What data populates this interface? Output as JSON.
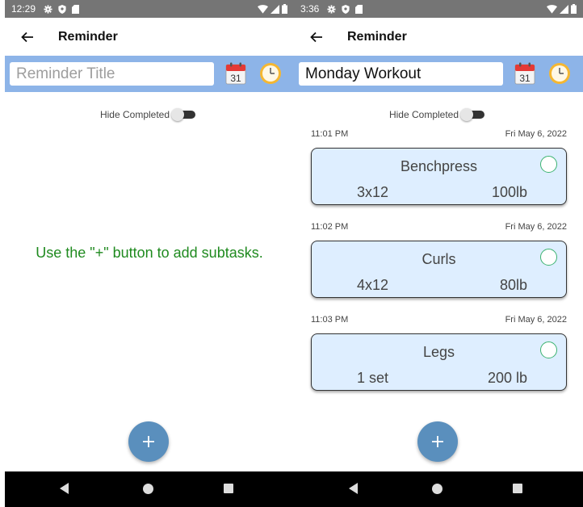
{
  "screens": [
    {
      "statusbar": {
        "time": "12:29"
      },
      "appbar": {
        "title": "Reminder"
      },
      "title_input": {
        "value": "",
        "placeholder": "Reminder Title"
      },
      "calendar_day": "31",
      "hide_completed_label": "Hide Completed",
      "hide_completed_on": false,
      "empty_message": "Use the \"+\" button to add subtasks.",
      "fab_label": "+"
    },
    {
      "statusbar": {
        "time": "3:36"
      },
      "appbar": {
        "title": "Reminder"
      },
      "title_input": {
        "value": "Monday Workout",
        "placeholder": "Reminder Title"
      },
      "calendar_day": "31",
      "hide_completed_label": "Hide Completed",
      "hide_completed_on": false,
      "tasks": [
        {
          "time": "11:01 PM",
          "date": "Fri May 6, 2022",
          "name": "Benchpress",
          "reps": "3x12",
          "weight": "100lb"
        },
        {
          "time": "11:02 PM",
          "date": "Fri May 6, 2022",
          "name": "Curls",
          "reps": "4x12",
          "weight": "80lb"
        },
        {
          "time": "11:03 PM",
          "date": "Fri May 6, 2022",
          "name": "Legs",
          "reps": "1 set",
          "weight": "200 lb"
        }
      ],
      "fab_label": "+"
    }
  ],
  "colors": {
    "statusbar": "#757575",
    "titlebar": "#8db4e8",
    "card": "#deeeff",
    "fab": "#5a8fbd",
    "empty_text": "#1f8a1f",
    "check_ring": "#3cb371"
  },
  "icons": [
    "gear-icon",
    "shield-icon",
    "sd-card-icon",
    "wifi-icon",
    "signal-icon",
    "battery-icon",
    "back-arrow-icon",
    "calendar-icon",
    "clock-icon",
    "plus-icon",
    "nav-back-icon",
    "nav-home-icon",
    "nav-recents-icon"
  ]
}
